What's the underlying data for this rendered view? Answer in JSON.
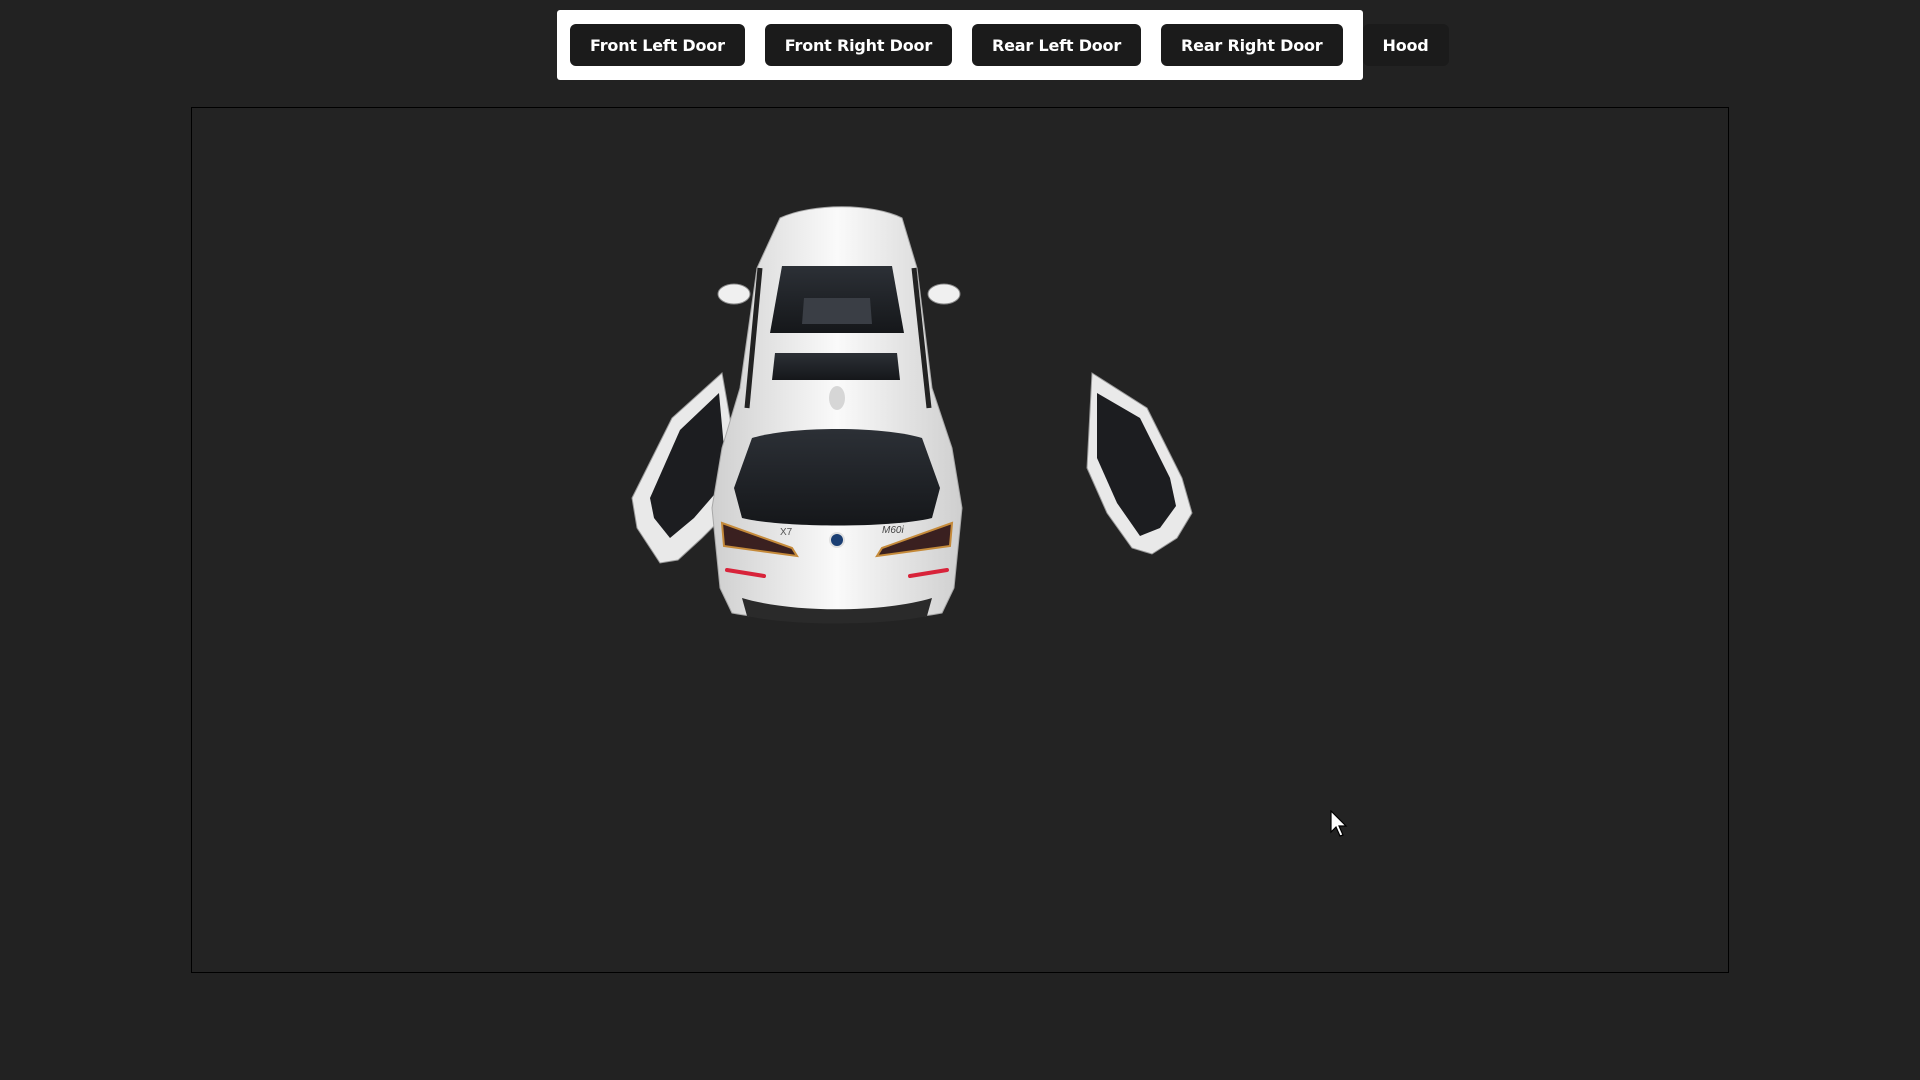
{
  "toolbar": {
    "buttons": [
      {
        "label": "Front Left Door"
      },
      {
        "label": "Front Right Door"
      },
      {
        "label": "Rear Left Door"
      },
      {
        "label": "Rear Right Door"
      },
      {
        "label": "Hood"
      }
    ]
  },
  "viewer": {
    "model_badges": {
      "left": "X7",
      "right": "M60i"
    },
    "colors": {
      "background": "#232323",
      "car_body": "#f2f2f2",
      "glass": "#1e2125",
      "taillight": "#d8233a"
    }
  },
  "cursor": {
    "icon": "arrow-pointer-icon"
  }
}
